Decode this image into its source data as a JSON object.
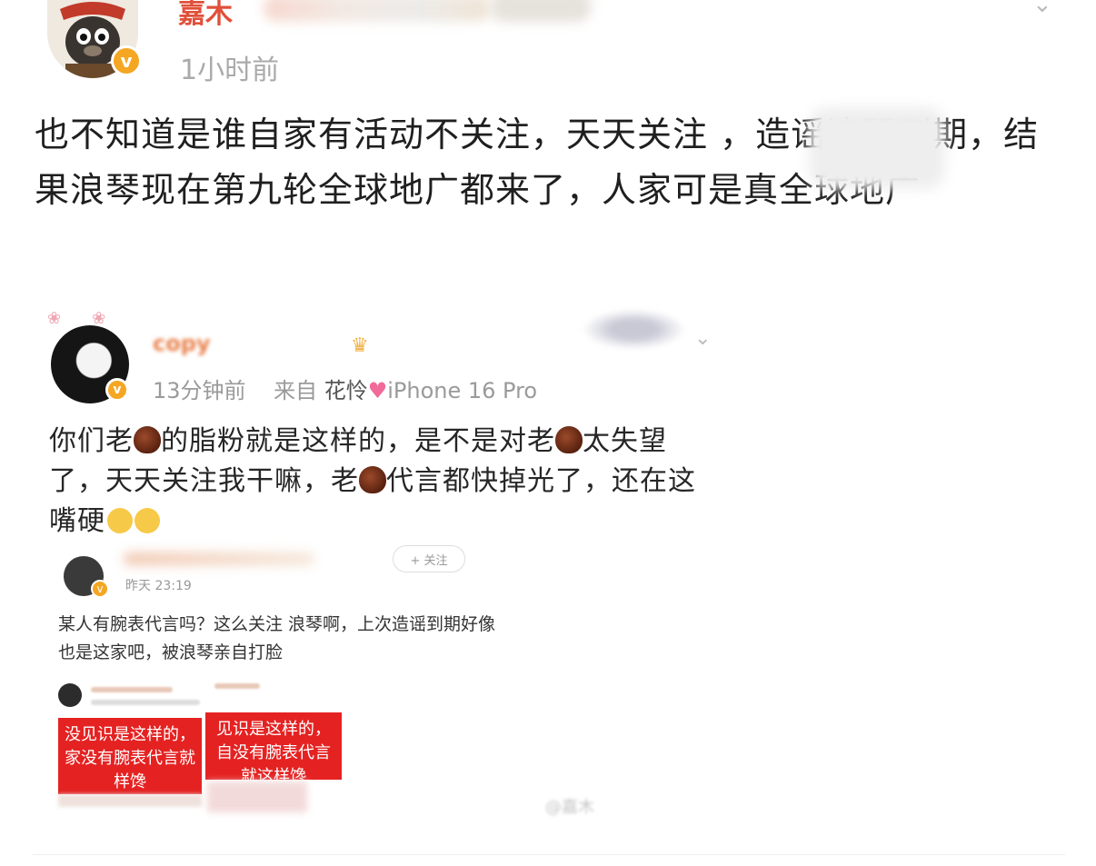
{
  "post": {
    "username": "嘉木",
    "time": "1小时前",
    "more_icon": "chevron-down-icon",
    "text": "也不知道是谁自家有活动不关注，天天关注 ，造谣浪琴到期，结果浪琴现在第九轮全球地广都来了，人家可是真全球地广"
  },
  "quoted": {
    "username": "copy",
    "time": "13分钟前",
    "from_label": "来自",
    "app": "花怜",
    "device": "iPhone 16 Pro",
    "text_parts": [
      "你们老",
      "的脂粉就是这样的，是不是对老",
      "太失望了，天天关注我干嘛，老",
      "代言都快掉光了，还在这嘴硬"
    ]
  },
  "nested": {
    "time": "昨天 23:19",
    "follow_label": "+ 关注",
    "text": "某人有腕表代言吗？这么关注 浪琴啊，上次造谣到期好像也是这家吧，被浪琴亲自打脸"
  },
  "mini": {
    "box1_text": "没见识是这样的，家没有腕表代言就样馋",
    "box2_text": "见识是这样的，自没有腕表代言就这样馋",
    "watermark": "@嘉木"
  }
}
